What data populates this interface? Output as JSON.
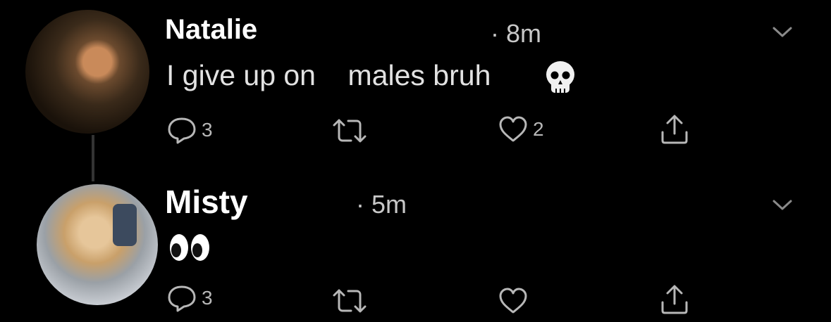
{
  "tweets": [
    {
      "author": "Natalie",
      "time": "· 8m",
      "text": "I give up on    males bruh",
      "emoji": "skull",
      "actions": {
        "reply_count": "3",
        "retweet_count": "",
        "like_count": "2"
      },
      "avatar": "natalie-avatar"
    },
    {
      "author": "Misty",
      "time": "· 5m",
      "text": "",
      "emoji": "eyes",
      "actions": {
        "reply_count": "3",
        "retweet_count": "",
        "like_count": ""
      },
      "avatar": "misty-avatar"
    }
  ],
  "icons": [
    "reply-icon",
    "retweet-icon",
    "like-icon",
    "share-icon",
    "chevron-down-icon",
    "skull-emoji",
    "eyes-emoji"
  ],
  "colors": {
    "background": "#000000",
    "text": "#ffffff",
    "muted": "#b7b7b7"
  }
}
